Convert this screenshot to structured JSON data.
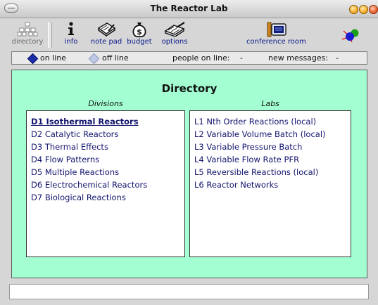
{
  "window": {
    "title": "The Reactor Lab"
  },
  "toolbar": {
    "directory_label": "directory",
    "info_label": "info",
    "notepad_label": "note pad",
    "budget_label": "budget",
    "options_label": "options",
    "conference_label": "conference room"
  },
  "status": {
    "online_label": "on line",
    "offline_label": "off line",
    "people_label": "people on line:",
    "people_value": "-",
    "messages_label": "new messages:",
    "messages_value": "-"
  },
  "directory": {
    "title": "Directory",
    "divisions_header": "Divisions",
    "labs_header": "Labs",
    "divisions": [
      "D1  Isothermal Reactors",
      "D2  Catalytic Reactors",
      "D3  Thermal Effects",
      "D4  Flow Patterns",
      "D5  Multiple Reactions",
      "D6  Electrochemical Reactors",
      "D7  Biological Reactions"
    ],
    "labs": [
      "L1  Nth Order Reactions (local)",
      "L2  Variable Volume Batch (local)",
      "L3  Variable Pressure Batch",
      "L4  Variable Flow Rate PFR",
      "L5  Reversible Reactions (local)",
      "L6  Reactor Networks"
    ]
  },
  "colors": {
    "panel_bg": "#a3ffd2",
    "link_text": "#12146e",
    "toolbar_text": "#0a1a8a"
  },
  "icons": [
    "collapse-icon",
    "minimize-icon",
    "zoom-icon",
    "close-icon",
    "directory-icon",
    "info-icon",
    "notepad-icon",
    "budget-icon",
    "options-icon",
    "conference-room-icon",
    "molecule-logo-icon"
  ]
}
